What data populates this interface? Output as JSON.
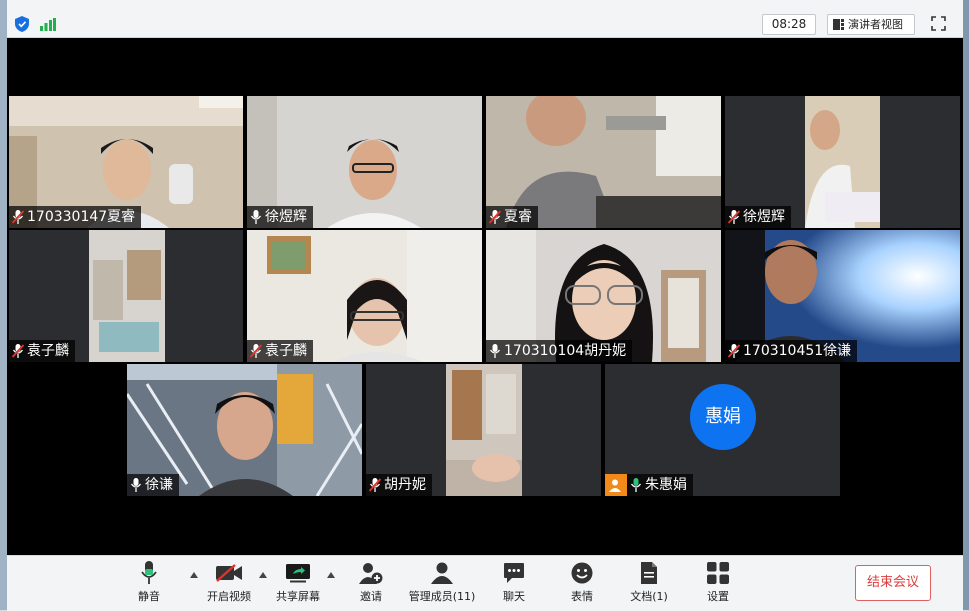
{
  "topbar": {
    "time": "08:28",
    "view_button": "演讲者视图",
    "security_icon": "shield-icon",
    "signal_icon": "signal-bars-icon",
    "fullscreen_icon": "fullscreen-icon"
  },
  "participants": [
    {
      "name": "170330147夏睿",
      "mic": "muted"
    },
    {
      "name": "徐煜辉",
      "mic": "on"
    },
    {
      "name": "夏睿",
      "mic": "muted"
    },
    {
      "name": "徐煜辉",
      "mic": "muted"
    },
    {
      "name": "袁子麟",
      "mic": "muted"
    },
    {
      "name": "袁子麟",
      "mic": "muted"
    },
    {
      "name": "170310104胡丹妮",
      "mic": "on",
      "active_speaker": true
    },
    {
      "name": "170310451徐谦",
      "mic": "muted"
    },
    {
      "name": "徐谦",
      "mic": "on"
    },
    {
      "name": "胡丹妮",
      "mic": "muted"
    },
    {
      "name": "朱惠娟",
      "mic": "on",
      "video": "off",
      "avatar_text": "惠娟"
    }
  ],
  "toolbar": {
    "mute": "静音",
    "start_video": "开启视频",
    "share_screen": "共享屏幕",
    "invite": "邀请",
    "manage_participants": "管理成员(11)",
    "chat": "聊天",
    "reactions": "表情",
    "documents": "文档(1)",
    "settings": "设置",
    "end_meeting": "结束会议"
  },
  "colors": {
    "accent_green": "#2bc37a",
    "avatar_blue": "#0e73f0",
    "end_red": "#e03a3a",
    "user_badge_orange": "#f28a1a"
  }
}
